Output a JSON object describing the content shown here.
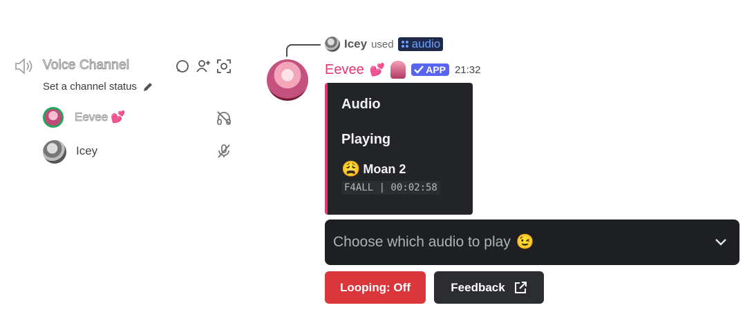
{
  "voice_channel": {
    "title": "Voice Channel",
    "status_placeholder": "Set a channel status",
    "members": [
      {
        "name": "Eevee",
        "emoji": "💕"
      },
      {
        "name": "Icey"
      }
    ]
  },
  "message": {
    "reply": {
      "user": "Icey",
      "used_text": "used",
      "command": "audio"
    },
    "author": "Eevee",
    "author_emoji": "💕",
    "app_badge": "APP",
    "timestamp": "21:32",
    "embed": {
      "title": "Audio",
      "subtitle": "Playing",
      "track_emoji": "😩",
      "track": "Moan 2",
      "meta": "F4ALL | 00:02:58"
    },
    "select": {
      "placeholder": "Choose which audio to play",
      "emoji": "😉"
    },
    "buttons": {
      "looping": "Looping: Off",
      "feedback": "Feedback"
    }
  },
  "colors": {
    "accent_pink": "#e6356f",
    "danger": "#da373c",
    "app_badge": "#5865f2",
    "embed_bg": "#232428"
  }
}
